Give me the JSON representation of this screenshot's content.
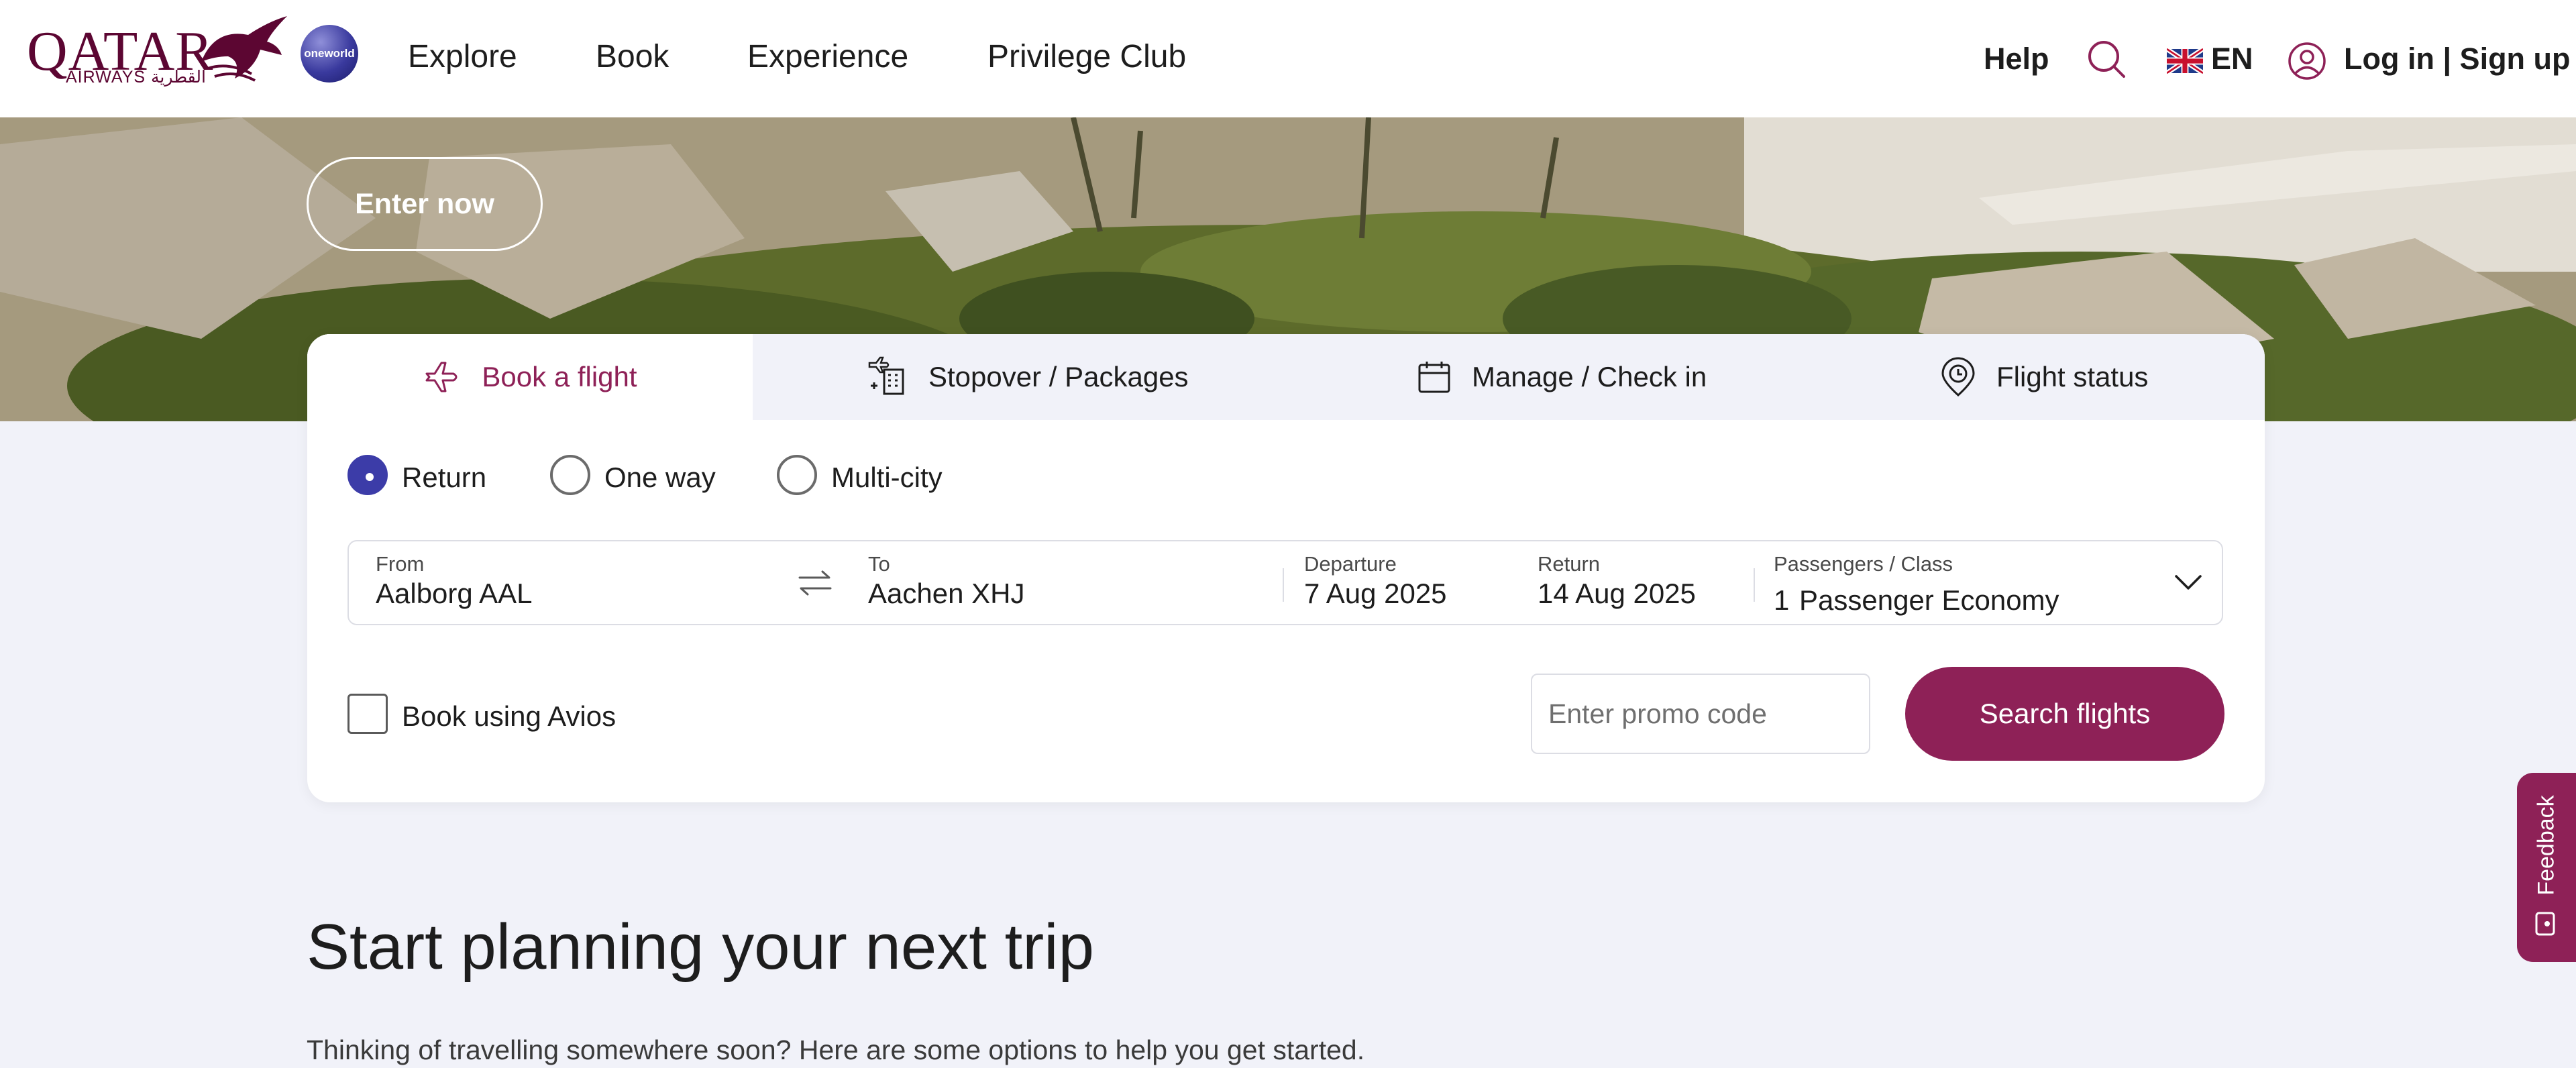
{
  "brand": {
    "logo_text": "QATAR",
    "logo_sub": "AIRWAYS القطرية",
    "oneworld": "oneworld"
  },
  "nav": {
    "items": [
      "Explore",
      "Book",
      "Experience",
      "Privilege Club"
    ]
  },
  "header_right": {
    "help": "Help",
    "language": "EN",
    "login": "Log in | Sign up"
  },
  "hero": {
    "cta": "Enter now"
  },
  "booking": {
    "tabs": [
      {
        "label": "Book a flight",
        "icon": "plane-icon",
        "active": true
      },
      {
        "label": "Stopover / Packages",
        "icon": "hotel-plane-icon"
      },
      {
        "label": "Manage / Check in",
        "icon": "calendar-icon"
      },
      {
        "label": "Flight status",
        "icon": "location-clock-icon"
      }
    ],
    "trip_types": [
      "Return",
      "One way",
      "Multi-city"
    ],
    "selected_trip": "Return",
    "from": {
      "label": "From",
      "value": "Aalborg AAL"
    },
    "to": {
      "label": "To",
      "value": "Aachen XHJ"
    },
    "departure": {
      "label": "Departure",
      "value": "7 Aug 2025"
    },
    "return": {
      "label": "Return",
      "value": "14 Aug 2025"
    },
    "passengers": {
      "label": "Passengers / Class",
      "count": "1",
      "value": "Passenger Economy"
    },
    "avios_label": "Book using Avios",
    "promo_placeholder": "Enter promo code",
    "search_label": "Search flights"
  },
  "content": {
    "title": "Start planning your next trip",
    "subtitle": "Thinking of travelling somewhere soon? Here are some options to help you get started."
  },
  "feedback": {
    "label": "Feedback"
  },
  "colors": {
    "brand": "#8e2157",
    "radio": "#3c3ca8",
    "background": "#f1f2f9"
  }
}
